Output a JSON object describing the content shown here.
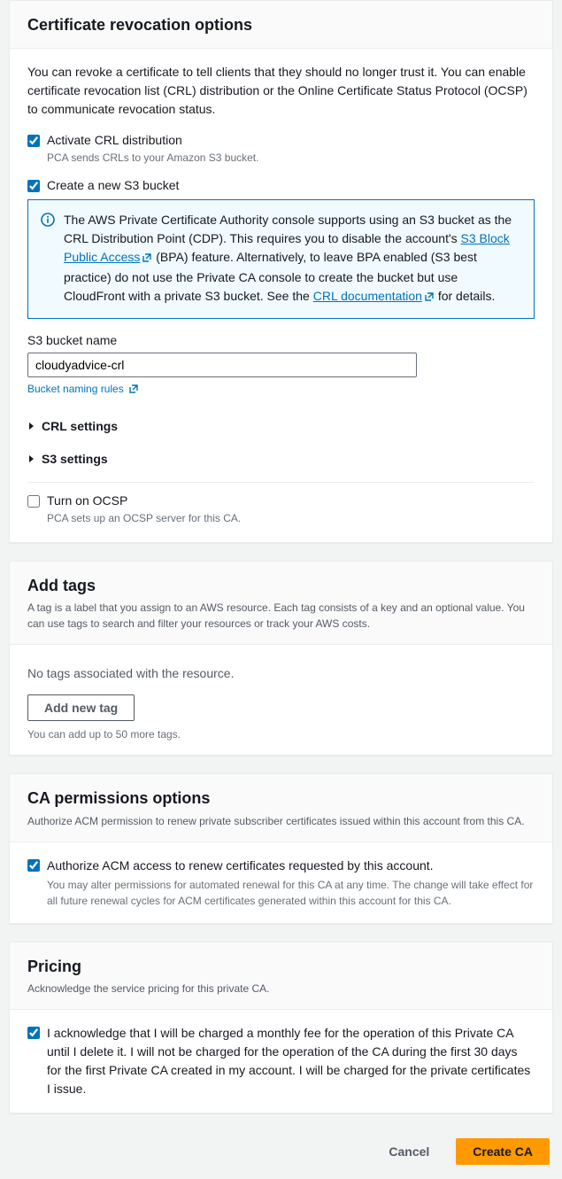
{
  "revocation": {
    "title": "Certificate revocation options",
    "intro": "You can revoke a certificate to tell clients that they should no longer trust it. You can enable certificate revocation list (CRL) distribution or the Online Certificate Status Protocol (OCSP) to communicate revocation status.",
    "crl_activate_label": "Activate CRL distribution",
    "crl_activate_desc": "PCA sends CRLs to your Amazon S3 bucket.",
    "create_bucket_label": "Create a new S3 bucket",
    "info": {
      "part1": "The AWS Private Certificate Authority console supports using an S3 bucket as the CRL Distribution Point (CDP). This requires you to disable the account's ",
      "link1": "S3 Block Public Access",
      "part2": " (BPA) feature. Alternatively, to leave BPA enabled (S3 best practice) do not use the Private CA console to create the bucket but use CloudFront with a private S3 bucket. See the ",
      "link2": "CRL documentation",
      "part3": " for details."
    },
    "bucket_name_label": "S3 bucket name",
    "bucket_name_value": "cloudyadvice-crl",
    "bucket_naming_link": "Bucket naming rules",
    "crl_settings_label": "CRL settings",
    "s3_settings_label": "S3 settings",
    "ocsp_label": "Turn on OCSP",
    "ocsp_desc": "PCA sets up an OCSP server for this CA."
  },
  "tags": {
    "title": "Add tags",
    "sub": "A tag is a label that you assign to an AWS resource. Each tag consists of a key and an optional value. You can use tags to search and filter your resources or track your AWS costs.",
    "empty": "No tags associated with the resource.",
    "add_button": "Add new tag",
    "hint": "You can add up to 50 more tags."
  },
  "permissions": {
    "title": "CA permissions options",
    "sub": "Authorize ACM permission to renew private subscriber certificates issued within this account from this CA.",
    "authorize_label": "Authorize ACM access to renew certificates requested by this account.",
    "authorize_desc": "You may alter permissions for automated renewal for this CA at any time. The change will take effect for all future renewal cycles for ACM certificates generated within this account for this CA."
  },
  "pricing": {
    "title": "Pricing",
    "sub": "Acknowledge the service pricing for this private CA.",
    "ack_label": "I acknowledge that I will be charged a monthly fee for the operation of this Private CA until I delete it. I will not be charged for the operation of the CA during the first 30 days for the first Private CA created in my account. I will be charged for the private certificates I issue."
  },
  "footer": {
    "cancel": "Cancel",
    "create": "Create CA"
  }
}
